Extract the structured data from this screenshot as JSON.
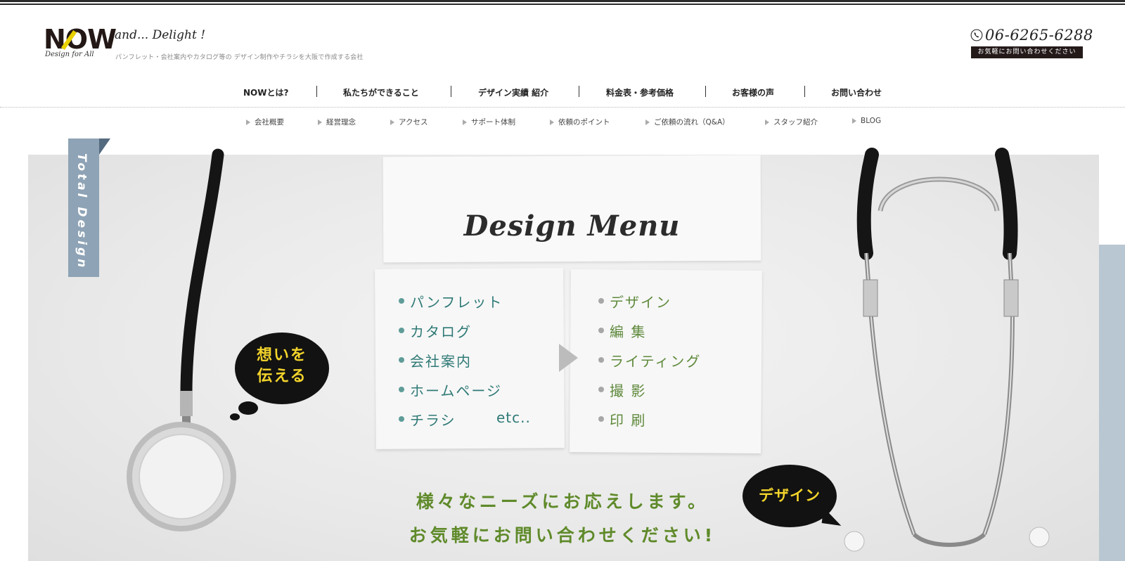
{
  "header": {
    "logo_word": "NOW",
    "logo_sub": "Design for All",
    "tagline_script": "and... Delight !",
    "tagline_sub": "パンフレット・会社案内やカタログ等の デザイン制作やチラシを大阪で作成する会社",
    "phone_number": "06-6265-6288",
    "phone_cta": "お気軽にお問い合わせください"
  },
  "main_nav": [
    {
      "label": "NOWとは?"
    },
    {
      "label": "私たちができること"
    },
    {
      "label": "デザイン実績 紹介"
    },
    {
      "label": "料金表・参考価格"
    },
    {
      "label": "お客様の声"
    },
    {
      "label": "お問い合わせ"
    }
  ],
  "sub_nav": [
    {
      "label": "会社概要"
    },
    {
      "label": "経営理念"
    },
    {
      "label": "アクセス"
    },
    {
      "label": "サポート体制"
    },
    {
      "label": "依頼のポイント"
    },
    {
      "label": "ご依頼の流れ（Q&A）"
    },
    {
      "label": "スタッフ紹介"
    },
    {
      "label": "BLOG"
    }
  ],
  "hero": {
    "ribbon_label": "Total Design",
    "menu_title": "Design Menu",
    "left_items": [
      "パンフレット",
      "カタログ",
      "会社案内",
      "ホームページ",
      "チラシ"
    ],
    "left_etc": "etc..",
    "right_items": [
      "デザイン",
      "編 集",
      "ライティング",
      "撮 影",
      "印 刷"
    ],
    "bubble1_line1": "想いを",
    "bubble1_line2": "伝える",
    "bubble2": "デザイン",
    "cta_line1": "様々なニーズにお応えします。",
    "cta_line2": "お気軽にお問い合わせください!"
  },
  "colors": {
    "accent_yellow": "#f3d42b",
    "left_list_teal": "#2f7a76",
    "right_list_green": "#5f8a3c",
    "ribbon_blue": "#8ea3b5"
  },
  "icons": {
    "phone": "phone-icon",
    "nav_arrow": "triangle-right-icon"
  }
}
